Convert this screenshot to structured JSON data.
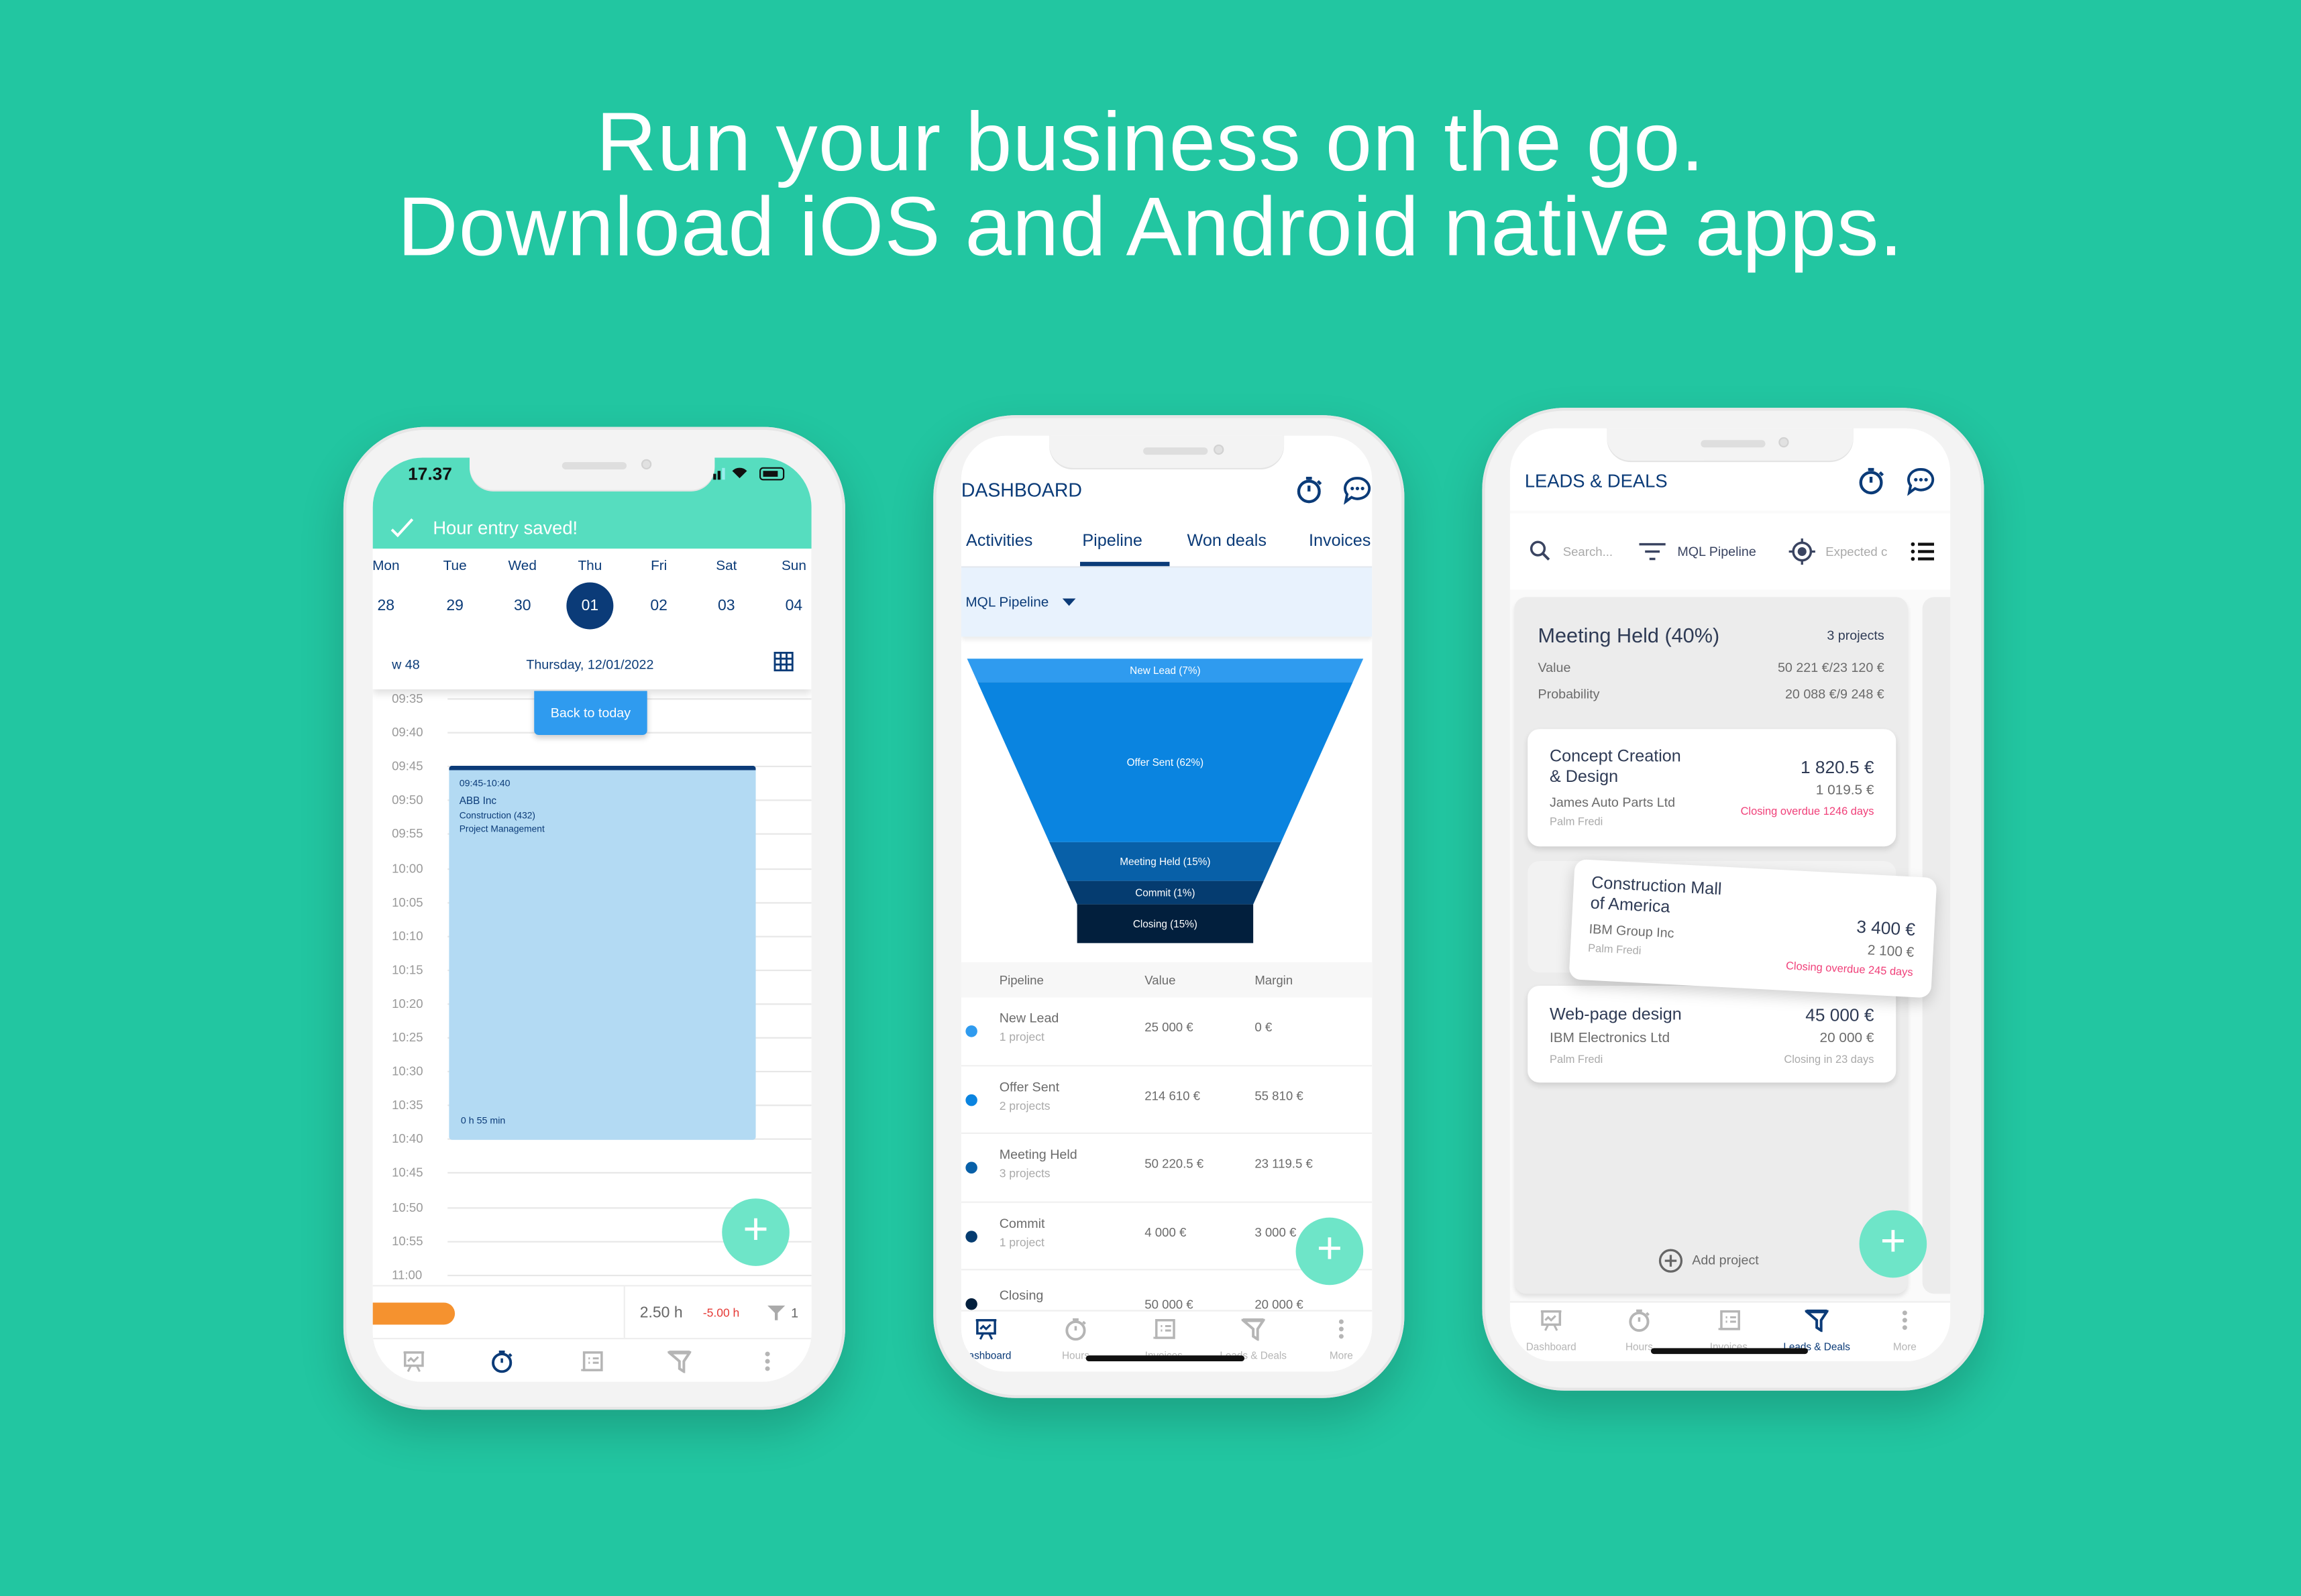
{
  "headline": {
    "line1": "Run your business on the go.",
    "line2": "Download iOS and Android native apps."
  },
  "colors": {
    "background": "#22c6a1",
    "navy": "#0b3b78",
    "mint": "#6ee5c8",
    "toast_green": "#56ddbf",
    "button_blue": "#2f9bef",
    "event_blue": "#b3daf3",
    "overdue_pink": "#f0417a",
    "orange": "#f5922f",
    "negative_red": "#e53935"
  },
  "phone_hours": {
    "status_time": "17.37",
    "toast": "Hour entry saved!",
    "days": [
      {
        "label": "Mon",
        "date": "28"
      },
      {
        "label": "Tue",
        "date": "29"
      },
      {
        "label": "Wed",
        "date": "30"
      },
      {
        "label": "Thu",
        "date": "01",
        "selected": true
      },
      {
        "label": "Fri",
        "date": "02"
      },
      {
        "label": "Sat",
        "date": "03"
      },
      {
        "label": "Sun",
        "date": "04"
      }
    ],
    "week": "w 48",
    "date_label": "Thursday, 12/01/2022",
    "back_to_today": "Back to today",
    "times": [
      "09:35",
      "09:40",
      "09:45",
      "09:50",
      "09:55",
      "10:00",
      "10:05",
      "10:10",
      "10:15",
      "10:20",
      "10:25",
      "10:30",
      "10:35",
      "10:40",
      "10:45",
      "10:50",
      "10:55",
      "11:00"
    ],
    "event": {
      "time_range": "09:45-10:40",
      "customer": "ABB Inc",
      "project": "Construction (432)",
      "task": "Project Management",
      "duration": "0 h 55 min"
    },
    "summary": {
      "hours": "2.50 h",
      "difference": "-5.00 h",
      "filter_count": "1"
    },
    "nav_icons": [
      "dashboard-icon",
      "hours-icon",
      "invoices-icon",
      "leads-deals-icon",
      "more-icon"
    ],
    "active_nav": 1
  },
  "phone_dashboard": {
    "title": "DASHBOARD",
    "tabs": [
      "Activities",
      "Pipeline",
      "Won deals",
      "Invoices"
    ],
    "active_tab": 1,
    "pipeline_select": "MQL Pipeline",
    "table": {
      "headers": [
        "Pipeline",
        "Value",
        "Margin"
      ],
      "rows": [
        {
          "name": "New Lead",
          "projects": "1 project",
          "value": "25 000 €",
          "margin": "0 €",
          "color": "#2f9bef"
        },
        {
          "name": "Offer Sent",
          "projects": "2 projects",
          "value": "214 610 €",
          "margin": "55 810 €",
          "color": "#0a84e0"
        },
        {
          "name": "Meeting Held",
          "projects": "3 projects",
          "value": "50 220.5 €",
          "margin": "23 119.5 €",
          "color": "#0860a8"
        },
        {
          "name": "Commit",
          "projects": "1 project",
          "value": "4 000 €",
          "margin": "3 000 €",
          "color": "#053c70"
        },
        {
          "name": "Closing",
          "projects": "",
          "value": "50 000 €",
          "margin": "20 000 €",
          "color": "#021f3d"
        }
      ]
    },
    "nav": [
      "Dashboard",
      "Hours",
      "Invoices",
      "Leads & Deals",
      "More"
    ],
    "active_nav": 0
  },
  "chart_data": {
    "type": "funnel",
    "categories": [
      "New Lead",
      "Offer Sent",
      "Meeting Held",
      "Commit",
      "Closing"
    ],
    "values": [
      7,
      62,
      15,
      1,
      15
    ],
    "labels": [
      "New Lead (7%)",
      "Offer Sent (62%)",
      "Meeting Held (15%)",
      "Commit (1%)",
      "Closing (15%)"
    ],
    "colors": [
      "#2f9bef",
      "#0a84e0",
      "#0860a8",
      "#053c70",
      "#021f3d"
    ]
  },
  "phone_leads": {
    "title": "LEADS & DEALS",
    "search_placeholder": "Search...",
    "pipeline_filter": "MQL Pipeline",
    "sort_label": "Expected c",
    "column": {
      "title": "Meeting Held (40%)",
      "count": "3 projects",
      "value_label": "Value",
      "value": "50 221 €/23 120 €",
      "probability_label": "Probability",
      "probability": "20 088 €/9 248 €"
    },
    "cards": [
      {
        "title1": "Concept Creation",
        "title2": "& Design",
        "company": "James Auto Parts Ltd",
        "owner": "Palm Fredi",
        "value": "1 820.5 €",
        "margin": "1 019.5 €",
        "closing": "Closing overdue 1246 days",
        "overdue": true
      },
      {
        "title1": "Construction Mall",
        "title2": "of America",
        "company": "IBM Group Inc",
        "owner": "Palm Fredi",
        "value": "3 400 €",
        "margin": "2 100 €",
        "closing": "Closing overdue 245 days",
        "overdue": true,
        "dragging": true
      },
      {
        "title1": "Web-page design",
        "company": "IBM Electronics Ltd",
        "owner": "Palm Fredi",
        "value": "45 000 €",
        "margin": "20 000 €",
        "closing": "Closing in 23 days",
        "overdue": false
      }
    ],
    "add_project": "Add project",
    "nav": [
      "Dashboard",
      "Hours",
      "Invoices",
      "Leads & Deals",
      "More"
    ],
    "active_nav": 3
  }
}
